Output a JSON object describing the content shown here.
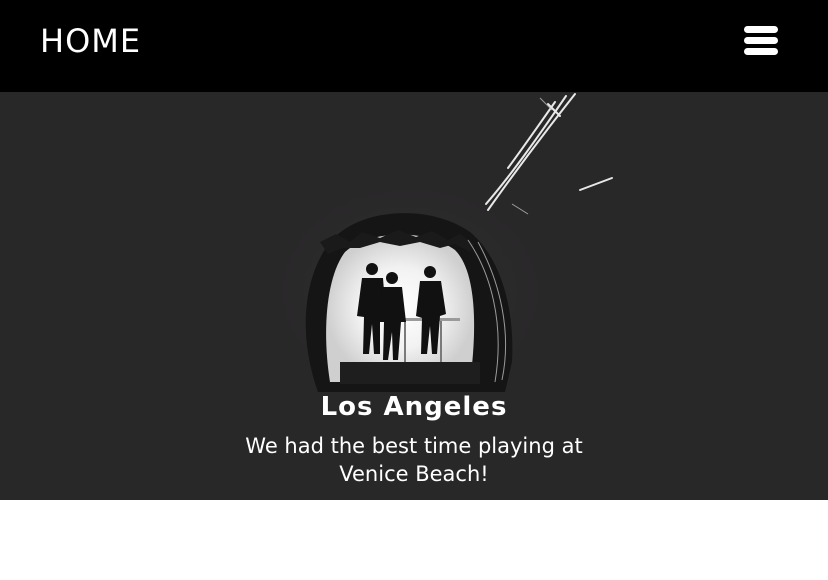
{
  "header": {
    "home_label": "HOME",
    "menu_icon": "hamburger-menu-icon"
  },
  "hero": {
    "title": "Los Angeles",
    "subtitle": "We had the best time playing at Venice Beach!",
    "image": "tunnel-silhouette-photo"
  },
  "colors": {
    "header_bg": "#000000",
    "hero_bg": "#292829",
    "text": "#ffffff",
    "page_bg": "#ffffff"
  }
}
